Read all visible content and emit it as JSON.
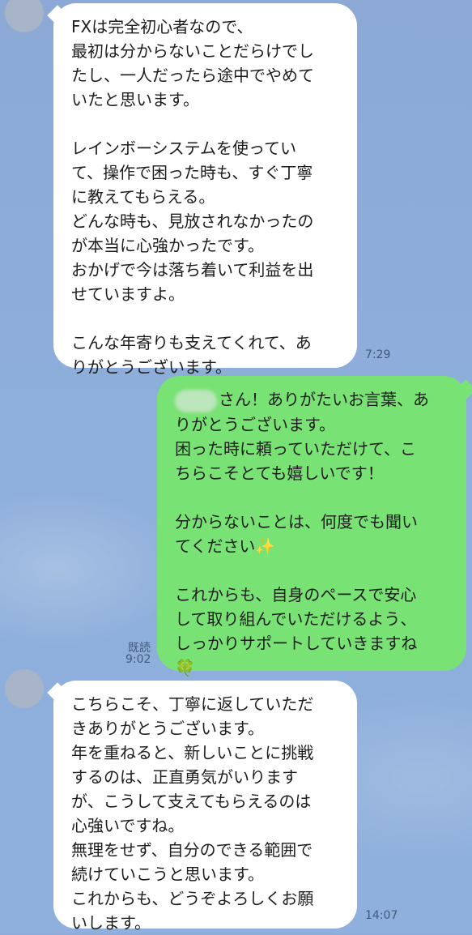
{
  "messages": [
    {
      "lines": [
        "FXは完全初心者なので、",
        "最初は分からないことだらけでし",
        "たし、一人だったら途中でやめて",
        "いたと思います。",
        "",
        "レインボーシステムを使ってい",
        "て、操作で困った時も、すぐ丁寧",
        "に教えてもらえる。",
        "どんな時も、見放されなかったの",
        "が本当に心強かったです。",
        "おかげで今は落ち着いて利益を出",
        "せていますよ。",
        "",
        "こんな年寄りも支えてくれて、あ",
        "りがとうございます。"
      ],
      "time": "7:29"
    },
    {
      "first_line_suffix": "さん！ありがたいお言葉、あ",
      "lines": [
        "りがとうございます。",
        "困った時に頼っていただけて、こ",
        "ちらこそとても嬉しいです！",
        "",
        "分からないことは、何度でも聞い",
        "てください",
        "",
        "これからも、自身のペースで安心",
        "して取り組んでいただけるよう、",
        "しっかりサポートしていきますね"
      ],
      "sparkle": "✨",
      "clover": "🍀",
      "read": "既読",
      "time": "9:02"
    },
    {
      "lines": [
        "こちらこそ、丁寧に返していただ",
        "きありがとうございます。",
        "年を重ねると、新しいことに挑戦",
        "するのは、正直勇気がいります",
        "が、こうして支えてもらえるのは",
        "心強いですね。",
        "無理をせず、自分のできる範囲で",
        "続けていこうと思います。",
        "これからも、どうぞよろしくお願",
        "いします。"
      ],
      "time": "14:07"
    }
  ]
}
